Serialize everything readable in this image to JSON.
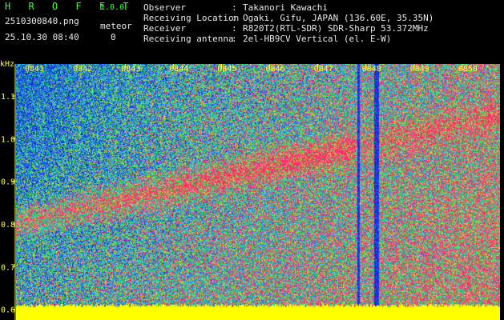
{
  "header": {
    "app_title": "H R O F F T",
    "app_version": "1.0.0",
    "file_name": "2510300840.png",
    "meteor_label": "meteor",
    "date_time": "25.10.30 08:40",
    "meteor_count": "0",
    "info": [
      {
        "label": "Observer",
        "value": "Takanori Kawachi"
      },
      {
        "label": "Receiving Location",
        "value": "Ogaki, Gifu, JAPAN (136.60E, 35.35N)"
      },
      {
        "label": "Receiver",
        "value": "R820T2(RTL-SDR) SDR-Sharp 53.372MHz"
      },
      {
        "label": "Receiving antenna",
        "value": "2el-HB9CV Vertical (el. E-W)"
      }
    ],
    "separator": ":"
  },
  "colors": {
    "label_green": "#3cff3c",
    "text_white": "#e8e8e8",
    "axis_yellow": "#ffff3c",
    "spectrogram_palette": [
      "#1a2ad8",
      "#2a6cf0",
      "#1fc7c7",
      "#2ee06a",
      "#c9d43a",
      "#ff2d6e"
    ],
    "baseline_band": "#ffff00"
  },
  "chart_data": {
    "type": "heatmap",
    "ylabel": "kHz",
    "y_ticks": [
      "1.1",
      "1.0",
      "0.9",
      "0.8",
      "0.7",
      "0.6"
    ],
    "y_tick_values": [
      1.1,
      1.0,
      0.9,
      0.8,
      0.7,
      0.6
    ],
    "ylim": [
      0.575,
      1.175
    ],
    "x_ticks": [
      "0841",
      "0842",
      "0843",
      "0844",
      "0845",
      "0846",
      "0847",
      "0848",
      "0849",
      "0850"
    ],
    "x_tick_values": [
      841,
      842,
      843,
      844,
      845,
      846,
      847,
      848,
      849,
      850
    ],
    "xlim": [
      840.4,
      850.45
    ],
    "vertical_interference_times": [
      847.5,
      847.85,
      847.9
    ],
    "grid": false
  }
}
